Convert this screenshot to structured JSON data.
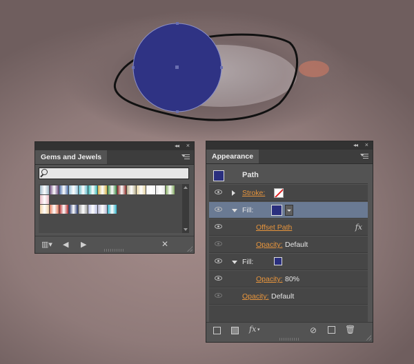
{
  "gems_panel": {
    "tab_label": "Gems and Jewels",
    "search_placeholder": "",
    "swatches_row1": [
      "#9fb8c7",
      "#6b4a7d",
      "#4c6da6",
      "#9ac7de",
      "#5db7c7",
      "#3ab7b3",
      "#d5b34a",
      "#3f8a48",
      "#8a2b26",
      "#b9b08c",
      "#e4d29f",
      "#f6f6f6",
      "#e9e9e9",
      "#7fa65d",
      "#e7b9c2"
    ],
    "swatches_row2": [
      "#efcfa2",
      "#e27b5c",
      "#b22d2f",
      "#26386e",
      "#9a9a9a",
      "#b7bde0",
      "#b8b8d4",
      "#2db0c8"
    ]
  },
  "appearance_panel": {
    "tab_label": "Appearance",
    "object_label": "Path",
    "fill_color": "#2a2f7e",
    "rows": {
      "stroke_label": "Stroke:",
      "fill1_label": "Fill:",
      "offset_path_label": "Offset Path",
      "fx_label": "fx",
      "opacity1_label": "Opacity:",
      "opacity1_value": "Default",
      "fill2_label": "Fill:",
      "opacity2_label": "Opacity:",
      "opacity2_value": "80%",
      "opacity3_label": "Opacity:",
      "opacity3_value": "Default"
    },
    "bottom_fx_label": "fx"
  },
  "artwork": {
    "circle_color": "#2f3384"
  }
}
